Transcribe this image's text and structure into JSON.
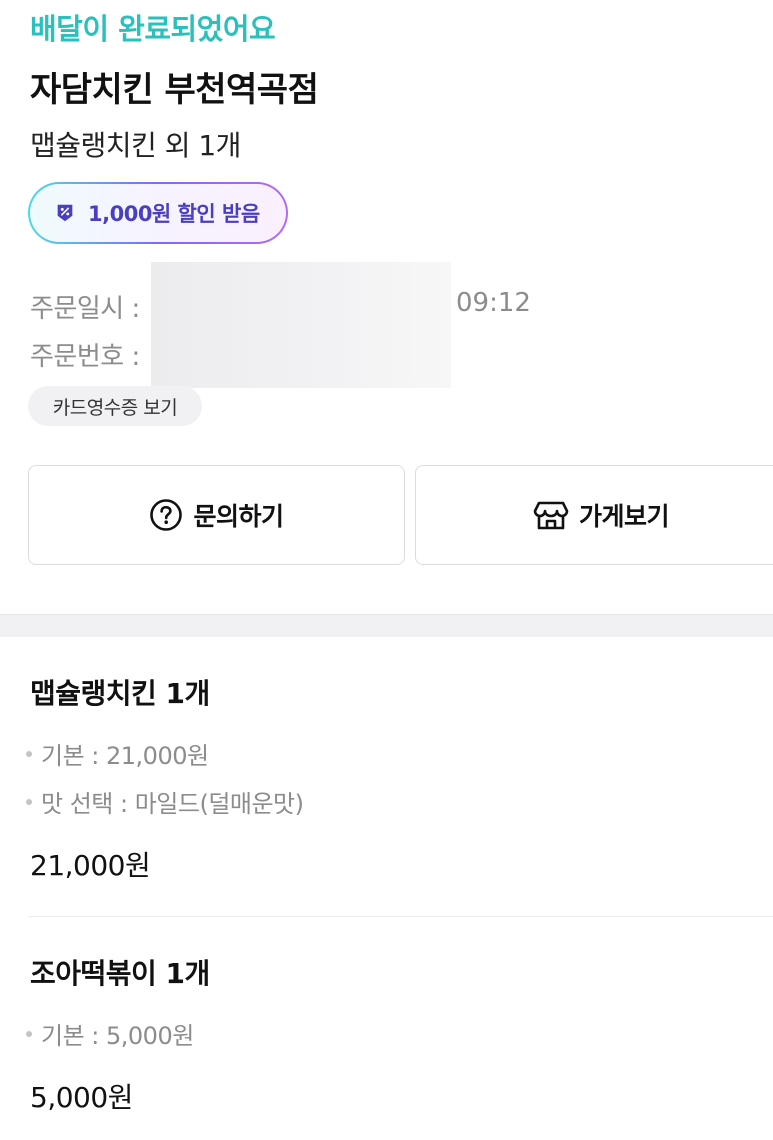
{
  "order": {
    "status": "배달이 완료되었어요",
    "store_name": "자담치킨 부천역곡점",
    "summary": "맵슐랭치킨 외 1개",
    "coupon_label": "1,000원 할인 받음",
    "order_datetime_label": "주문일시 :",
    "order_time_visible": "09:12",
    "order_number_label": "주문번호 :",
    "receipt_button": "카드영수증 보기",
    "inquiry_button": "문의하기",
    "store_button": "가게보기"
  },
  "items": [
    {
      "name": "맵슐랭치킨 1개",
      "options": [
        "기본 : 21,000원",
        "맛 선택 : 마일드(덜매운맛)"
      ],
      "price": "21,000원"
    },
    {
      "name": "조아떡볶이 1개",
      "options": [
        "기본 : 5,000원"
      ],
      "price": "5,000원"
    }
  ],
  "colors": {
    "status": "#2ac1bc",
    "coupon_text": "#4a3fbf",
    "muted": "#8c8c8c"
  },
  "icons": {
    "coupon": "discount-badge-icon",
    "inquiry": "question-circle-icon",
    "store": "store-icon"
  }
}
